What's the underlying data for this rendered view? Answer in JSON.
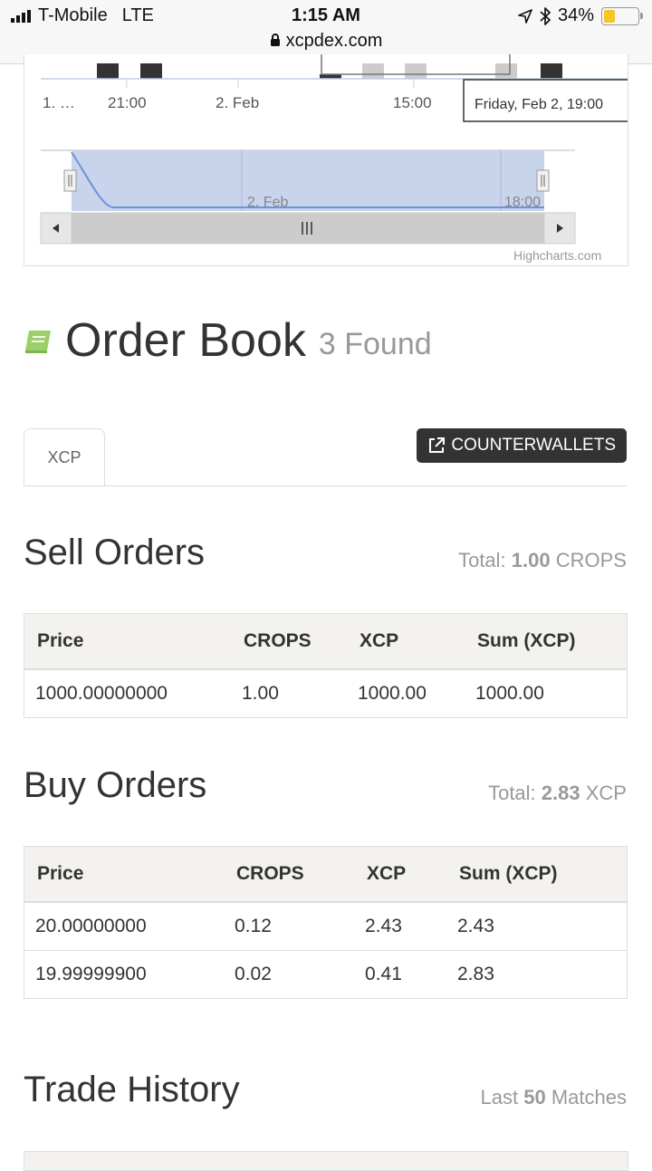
{
  "status": {
    "carrier": "T-Mobile",
    "network": "LTE",
    "time": "1:15 AM",
    "url": "xcpdex.com",
    "battery": "34%"
  },
  "chart": {
    "x_ticks": [
      "1. …",
      "21:00",
      "2. Feb",
      "15:00"
    ],
    "tooltip": "Friday, Feb 2, 19:00",
    "navigator_labels": [
      "2. Feb",
      "18:00"
    ],
    "credits": "Highcharts.com"
  },
  "order_book": {
    "title": "Order Book",
    "found": "3 Found",
    "tab": "XCP",
    "counterwallets": "COUNTERWALLETS"
  },
  "sell": {
    "title": "Sell Orders",
    "total_label": "Total:",
    "total_value": "1.00",
    "total_unit": "CROPS",
    "columns": [
      "Price",
      "CROPS",
      "XCP",
      "Sum (XCP)"
    ],
    "rows": [
      [
        "1000.00000000",
        "1.00",
        "1000.00",
        "1000.00"
      ]
    ]
  },
  "buy": {
    "title": "Buy Orders",
    "total_label": "Total:",
    "total_value": "2.83",
    "total_unit": "XCP",
    "columns": [
      "Price",
      "CROPS",
      "XCP",
      "Sum (XCP)"
    ],
    "rows": [
      [
        "20.00000000",
        "0.12",
        "2.43",
        "2.43"
      ],
      [
        "19.99999900",
        "0.02",
        "0.41",
        "2.83"
      ]
    ]
  },
  "trade_history": {
    "title": "Trade History",
    "last_label": "Last",
    "last_value": "50",
    "last_unit": "Matches"
  }
}
